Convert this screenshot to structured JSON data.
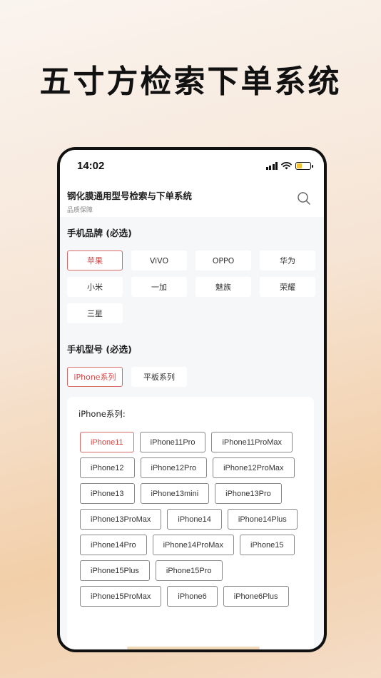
{
  "headline": "五寸方检索下单系统",
  "status": {
    "time": "14:02"
  },
  "app": {
    "title": "钢化膜通用型号检索与下单系统",
    "subtitle": "品质保障"
  },
  "brand_section": {
    "title": "手机品牌 (必选)",
    "items": [
      "苹果",
      "ViVO",
      "OPPO",
      "华为",
      "小米",
      "一加",
      "魅族",
      "荣耀",
      "三星"
    ],
    "selected": 0
  },
  "model_section": {
    "title": "手机型号 (必选)",
    "items": [
      "iPhone系列",
      "平板系列"
    ],
    "selected": 0
  },
  "series": {
    "title": "iPhone系列:",
    "items": [
      "iPhone11",
      "iPhone11Pro",
      "iPhone11ProMax",
      "iPhone12",
      "iPhone12Pro",
      "iPhone12ProMax",
      "iPhone13",
      "iPhone13mini",
      "iPhone13Pro",
      "iPhone13ProMax",
      "iPhone14",
      "iPhone14Plus",
      "iPhone14Pro",
      "iPhone14ProMax",
      "iPhone15",
      "iPhone15Plus",
      "iPhone15Pro",
      "iPhone15ProMax",
      "iPhone6",
      "iPhone6Plus"
    ],
    "selected": 0
  },
  "colors": {
    "accent": "#d64545",
    "battery": "#f2c230"
  }
}
